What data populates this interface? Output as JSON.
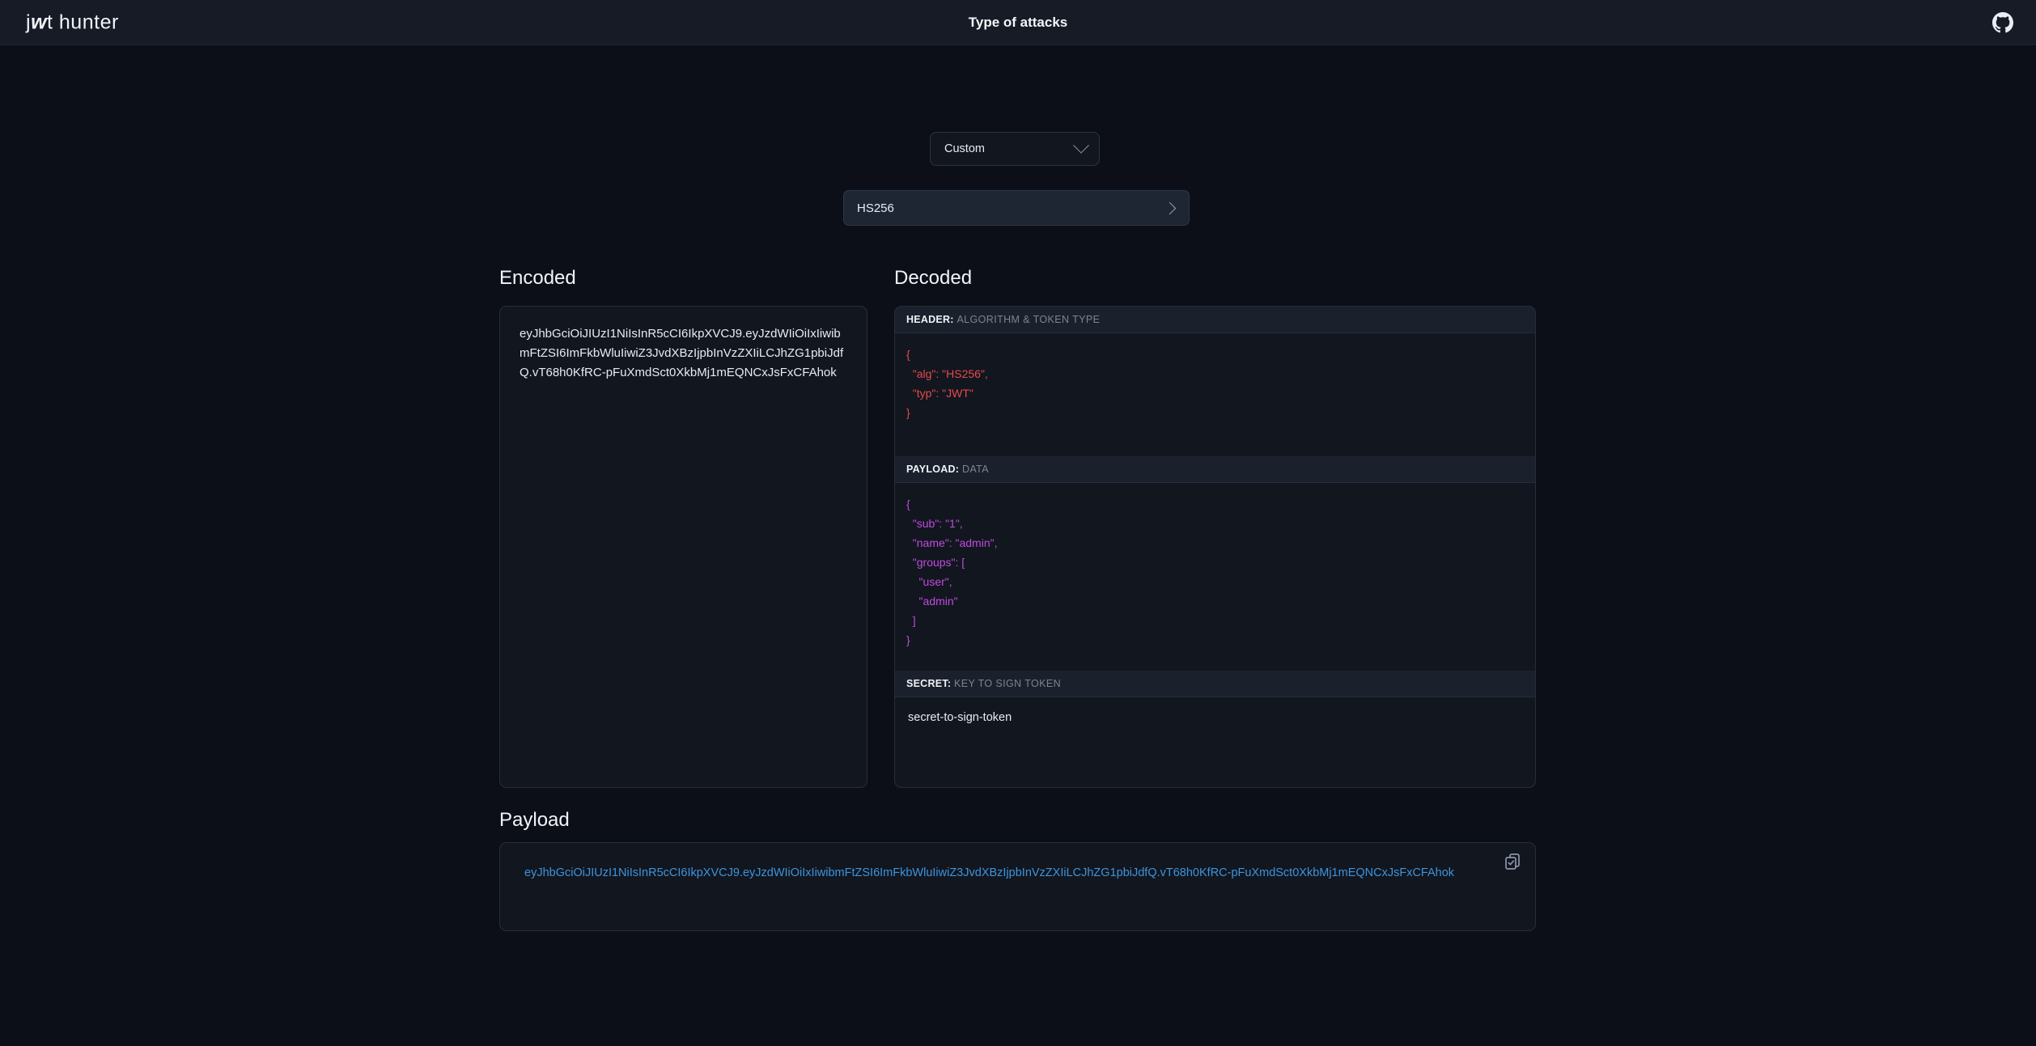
{
  "topbar": {
    "brand_prefix": "j",
    "brand_italic": "w",
    "brand_suffix": "t hunter",
    "title": "Type of attacks",
    "github_icon": "github-icon"
  },
  "controls": {
    "mode_select_value": "Custom",
    "mode_select_icon": "chevron-down-icon",
    "attack_label": "HS256",
    "attack_expand_icon": "chevron-right-icon"
  },
  "encoded": {
    "heading": "Encoded",
    "token": "eyJhbGciOiJIUzI1NiIsInR5cCI6IkpXVCJ9.eyJzdWIiOiIxIiwibmFtZSI6ImFkbWluIiwiZ3JvdXBzIjpbInVzZXIiLCJhZG1pbiJdfQ.vT68h0KfRC-pFuXmdSct0XkbMj1mEQNCxJsFxCFAhok"
  },
  "decoded": {
    "heading": "Decoded",
    "header": {
      "label": "HEADER:",
      "sublabel": "ALGORITHM & TOKEN TYPE",
      "json": "{\n  \"alg\": \"HS256\",\n  \"typ\": \"JWT\"\n}",
      "color": "#e64b4b"
    },
    "payload": {
      "label": "PAYLOAD:",
      "sublabel": "DATA",
      "json": "{\n  \"sub\": \"1\",\n  \"name\": \"admin\",\n  \"groups\": [\n    \"user\",\n    \"admin\"\n  ]\n}",
      "color": "#c14ae0"
    },
    "secret": {
      "label": "SECRET:",
      "sublabel": "KEY TO SIGN TOKEN",
      "value": "secret-to-sign-token"
    }
  },
  "payload_output": {
    "heading": "Payload",
    "token": "eyJhbGciOiJIUzI1NiIsInR5cCI6IkpXVCJ9.eyJzdWIiOiIxIiwibmFtZSI6ImFkbWluIiwiZ3JvdXBzIjpbInVzZXIiLCJhZG1pbiJdfQ.vT68h0KfRC-pFuXmdSct0XkbMj1mEQNCxJsFxCFAhok",
    "copy_icon": "copy-icon",
    "link_color": "#3d94dd"
  }
}
